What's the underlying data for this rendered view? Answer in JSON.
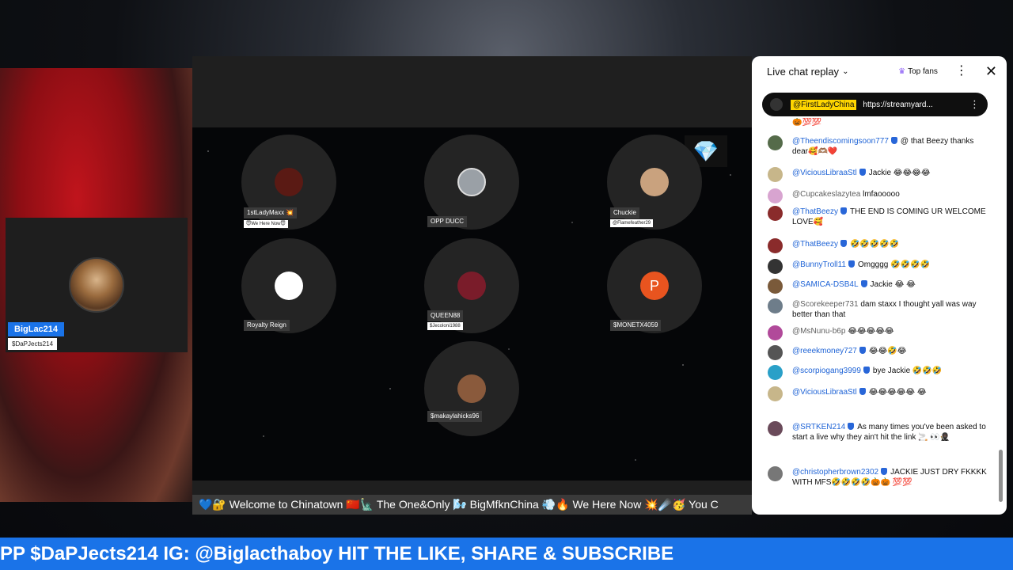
{
  "guest": {
    "name": "BigLac214",
    "handle": "$DaPJects214"
  },
  "stage": {
    "bubbles": [
      {
        "name": "1stLadyMaxx 💥",
        "sub": "😇We Here Now😇"
      },
      {
        "name": "OPP DUCC",
        "sub": ""
      },
      {
        "name": "Chuckie",
        "sub": "@Flamefeather29"
      },
      {
        "name": "Royalty Reign",
        "sub": ""
      },
      {
        "name": "QUEEN88",
        "sub": "$Jecoloni1988"
      },
      {
        "name": "P",
        "sub": ""
      },
      {
        "name": "$makaylahicks96",
        "sub": ""
      },
      {
        "name": "$MONETX4059",
        "sub": ""
      }
    ],
    "ticker": "💙🔐 Welcome to Chinatown 🇨🇳🗽 The One&Only 🌬️ BigMfknChina 💨🔥 We Here Now 💥☄️🥳 You C"
  },
  "banner": "PP $DaPJects214 IG: @Biglacthaboy HIT THE LIKE, SHARE & SUBSCRIBE",
  "chat": {
    "title": "Live chat replay",
    "top_fans": "Top fans",
    "pinned": {
      "user": "@FirstLadyChina",
      "message": "https://streamyard..."
    },
    "messages": [
      {
        "user": "",
        "text": "🎃💯💯",
        "color": "#ccc"
      },
      {
        "user": "@Theendiscomingsoon777",
        "text": "@ that Beezy thanks dear🥰🫶🏽❤️",
        "color": "#556b4a",
        "verified": true
      },
      {
        "user": "@ViciousLibraaStl",
        "text": "Jackie 😂😂😂😂",
        "color": "#c7b68a",
        "verified": true
      },
      {
        "user": "@Cupcakeslazytea",
        "text": "lmfaooooo",
        "color": "#d8a4d0",
        "verified": false
      },
      {
        "user": "@ThatBeezy",
        "text": "THE END IS COMING UR WELCOME LOVE🥰",
        "color": "#8a2b2b",
        "verified": true
      },
      {
        "user": "@ThatBeezy",
        "text": "🤣🤣🤣🤣🤣",
        "color": "#8a2b2b",
        "verified": true
      },
      {
        "user": "@BunnyTroll11",
        "text": "Omgggg 🤣🤣🤣🤣",
        "color": "#333",
        "verified": true
      },
      {
        "user": "@SAMICA-DSB4L",
        "text": "Jackie 😂 😂",
        "color": "#7a5a3a",
        "verified": true
      },
      {
        "user": "@Scorekeeper731",
        "text": "dam staxx I thought yall was way better than that",
        "color": "#6e7d8a",
        "verified": false
      },
      {
        "user": "@MsNunu-b6p",
        "text": "😂😂😂😂😂",
        "color": "#b14a9a",
        "verified": false
      },
      {
        "user": "@reeekmoney727",
        "text": "😂😂🤣😂",
        "color": "#555",
        "verified": true
      },
      {
        "user": "@scorpiogang3999",
        "text": "bye Jackie 🤣🤣🤣",
        "color": "#2aa0c8",
        "verified": true
      },
      {
        "user": "@ViciousLibraaStl",
        "text": "😂😂😂😂😂 😂",
        "color": "#c7b68a",
        "verified": true
      },
      {
        "user": "@SRTKEN214",
        "text": "As many times you've been asked to start a live why they ain't hit the link 🚬 👀🥷🏿",
        "color": "#6a4a5a",
        "verified": true
      },
      {
        "user": "@christopherbrown2302",
        "text": "JACKIE JUST DRY FKKKK WITH MFS🤣🤣🤣🤣🎃🎃 💯💯",
        "color": "#777",
        "verified": true
      }
    ]
  }
}
